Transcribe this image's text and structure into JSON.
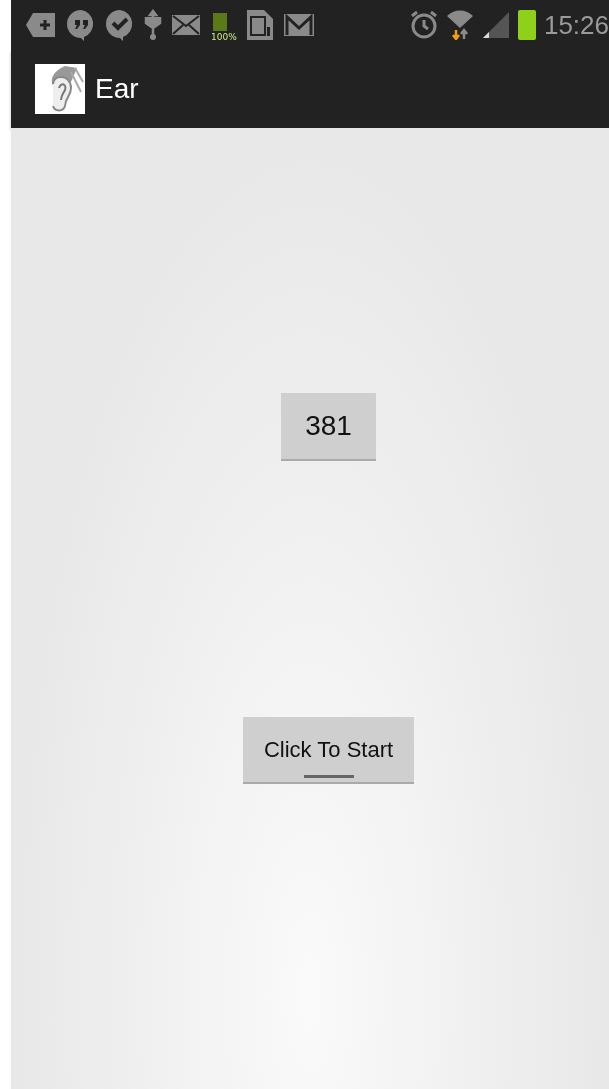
{
  "status_bar": {
    "battery_label": "100%",
    "time": "15:26"
  },
  "action_bar": {
    "title": "Ear"
  },
  "counter": {
    "value": "381"
  },
  "start_button": {
    "label": "Click To Start",
    "focused": true
  }
}
